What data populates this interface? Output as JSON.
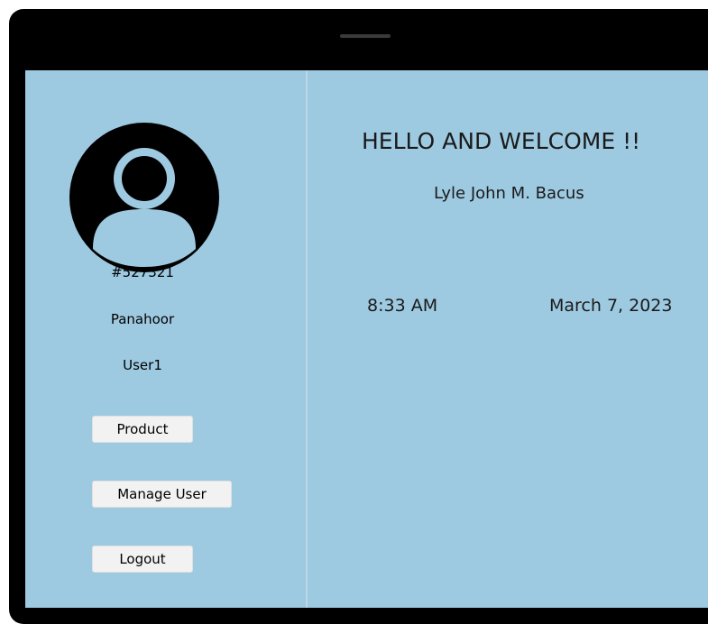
{
  "window": {
    "frame_color": "#000000",
    "screen_color": "#9ecae1"
  },
  "sidebar": {
    "avatar_icon": "user-avatar-icon",
    "user_id": "#527321",
    "last_name": "Panahoor",
    "username": "User1",
    "buttons": {
      "product_label": "Product",
      "manage_user_label": "Manage User",
      "logout_label": "Logout"
    }
  },
  "main": {
    "welcome_text": "HELLO AND WELCOME !!",
    "full_name": "Lyle John M. Bacus",
    "time": "8:33 AM",
    "date": "March 7, 2023"
  }
}
